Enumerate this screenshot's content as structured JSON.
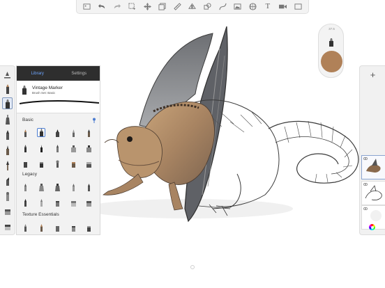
{
  "toolbar": {
    "items": [
      "gallery-icon",
      "undo-icon",
      "redo-icon",
      "selection-icon",
      "transform-icon",
      "layers-icon",
      "ruler-icon",
      "symmetry-icon",
      "shape-icon",
      "image-icon",
      "perspective-icon",
      "text-icon",
      "record-icon",
      "fullscreen-icon"
    ],
    "text_label": "T"
  },
  "brush_library": {
    "tabs": [
      {
        "label": "Library",
        "active": true
      },
      {
        "label": "Settings",
        "active": false
      }
    ],
    "current_brush": {
      "name": "Vintage Marker",
      "set": "Brush Set: Basic"
    },
    "sections": [
      {
        "title": "Basic",
        "rows": 3
      },
      {
        "title": "Legacy",
        "rows": 2
      },
      {
        "title": "Texture Essentials",
        "rows": 1
      }
    ]
  },
  "color_puck": {
    "brush_size": "37.5",
    "color": "#b08158"
  },
  "layers": {
    "add_label": "+",
    "count": 3,
    "selected_index": 0
  },
  "colors": {
    "toolbar_bg": "#f3f3f3",
    "tab_bar_bg": "#2e2e2e",
    "active_tab": "#6ea6ff",
    "selection": "#4a7bd0"
  }
}
